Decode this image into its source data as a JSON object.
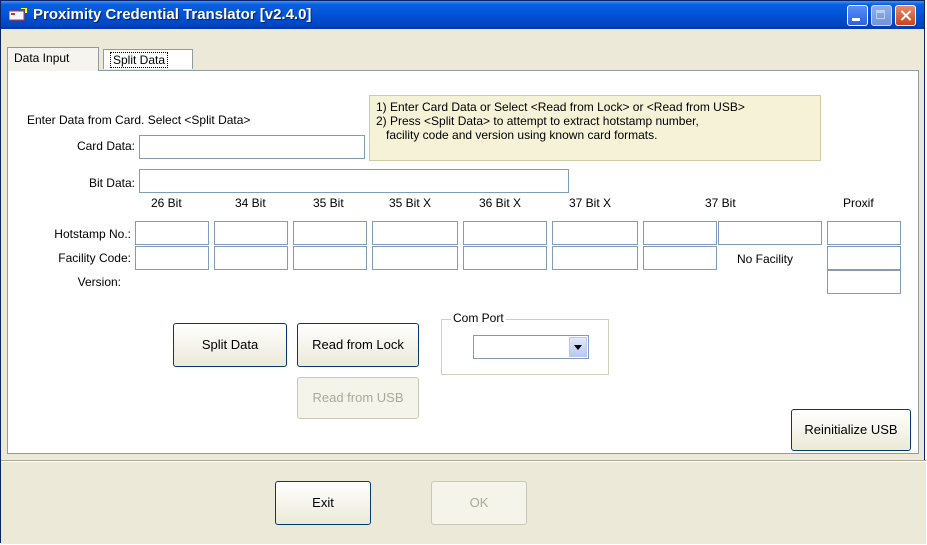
{
  "window": {
    "title": "Proximity Credential Translator [v2.4.0]"
  },
  "tabs": [
    {
      "label": "Data Input"
    },
    {
      "label": "Split Data"
    }
  ],
  "form": {
    "instruction": "Enter Data from Card. Select <Split Data>",
    "card_data_label": "Card Data:",
    "bit_data_label": "Bit Data:",
    "card_data_value": "",
    "bit_data_value": ""
  },
  "info": {
    "line1": "1) Enter Card Data or Select <Read from Lock> or <Read from USB>",
    "line2": "2) Press <Split Data> to attempt to extract hotstamp number,",
    "line3": "facility code and version using known card formats."
  },
  "grid": {
    "columns": [
      "26 Bit",
      "34 Bit",
      "35 Bit",
      "35 Bit X",
      "36 Bit X",
      "37 Bit X",
      "37 Bit",
      "Proxif"
    ],
    "row_labels": {
      "hotstamp": "Hotstamp No.:",
      "facility": "Facility Code:",
      "version": "Version:"
    },
    "no_facility": "No Facility"
  },
  "buttons": {
    "split": "Split Data",
    "read_lock": "Read from Lock",
    "read_usb": "Read from USB",
    "reinit": "Reinitialize USB",
    "exit": "Exit",
    "ok": "OK"
  },
  "com_port": {
    "label": "Com Port",
    "value": ""
  }
}
